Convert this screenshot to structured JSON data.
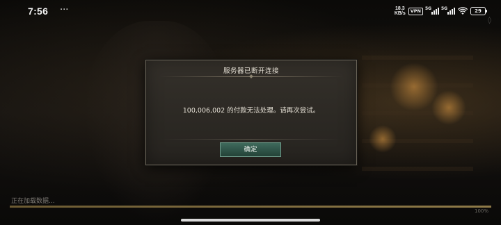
{
  "status_bar": {
    "time": "7:56",
    "more_indicator": "···",
    "net_speed_value": "18.3",
    "net_speed_unit": "KB/s",
    "vpn_label": "VPN",
    "signal_1_label": "5G",
    "signal_2_label": "5G",
    "battery_level": "29"
  },
  "dialog": {
    "title": "服务器已断开连接",
    "message": "100,006,002 的付款无法处理。请再次尝试。",
    "confirm_label": "确定"
  },
  "loading": {
    "label": "正在加载数据...",
    "progress_percent": 100,
    "progress_text": "100%"
  },
  "colors": {
    "accent_green": "#2e5246",
    "dialog_bg": "#2c2924",
    "progress_fill": "#8e7a48"
  }
}
